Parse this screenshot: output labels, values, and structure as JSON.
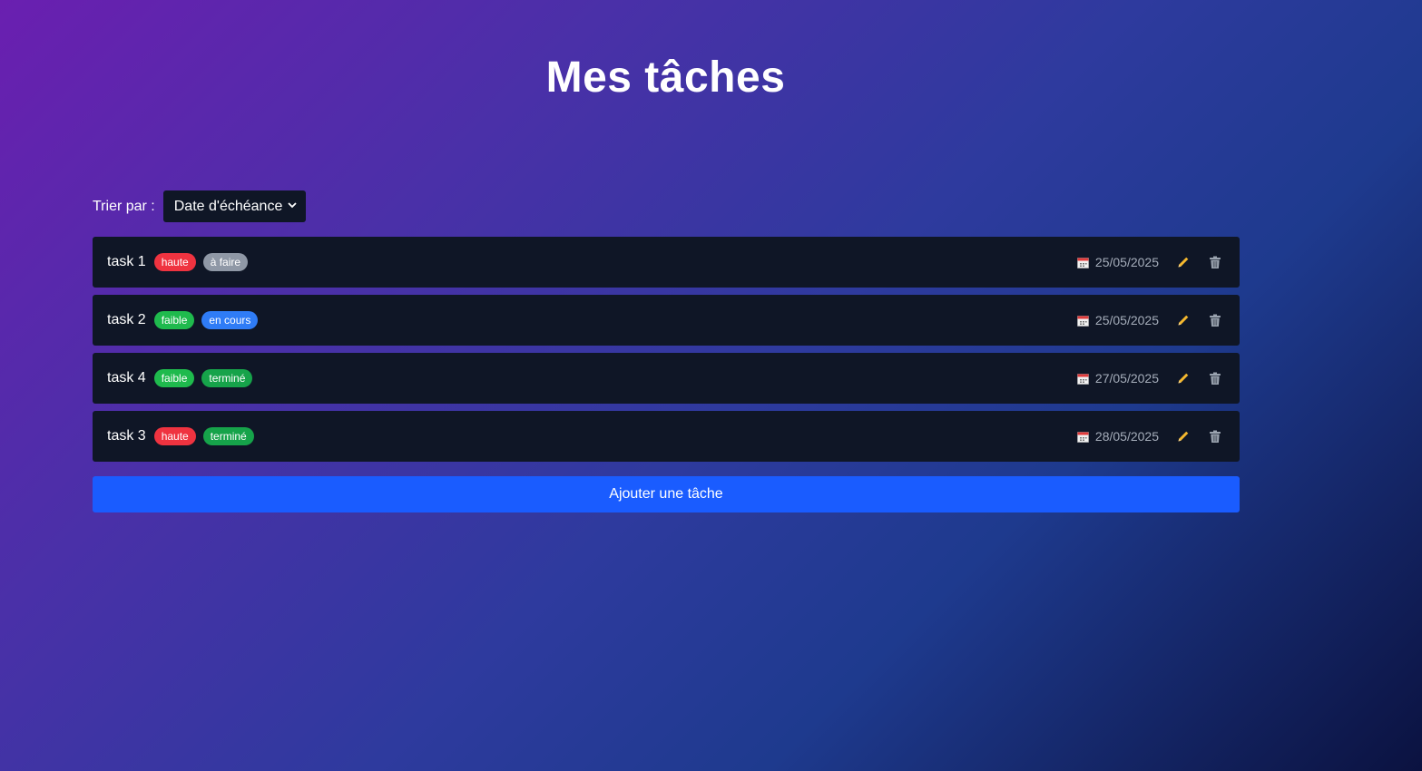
{
  "page": {
    "title": "Mes tâches"
  },
  "sort": {
    "label": "Trier par :",
    "selected": "Date d'échéance"
  },
  "tasks": [
    {
      "name": "task 1",
      "priority": {
        "label": "haute",
        "color": "#ef3340"
      },
      "status": {
        "label": "à faire",
        "color": "#8f98a6"
      },
      "due": "25/05/2025"
    },
    {
      "name": "task 2",
      "priority": {
        "label": "faible",
        "color": "#1fba4d"
      },
      "status": {
        "label": "en cours",
        "color": "#2f7cf6"
      },
      "due": "25/05/2025"
    },
    {
      "name": "task 4",
      "priority": {
        "label": "faible",
        "color": "#1fba4d"
      },
      "status": {
        "label": "terminé",
        "color": "#16a34a"
      },
      "due": "27/05/2025"
    },
    {
      "name": "task 3",
      "priority": {
        "label": "haute",
        "color": "#ef3340"
      },
      "status": {
        "label": "terminé",
        "color": "#16a34a"
      },
      "due": "28/05/2025"
    }
  ],
  "icons": {
    "date": "calendar-icon",
    "edit": "pencil-icon",
    "delete": "trash-icon"
  },
  "add_button": {
    "label": "Ajouter une tâche"
  },
  "colors": {
    "accent": "#1a5cff",
    "card": "#0f1626",
    "edit_icon": "#f5b82e"
  }
}
